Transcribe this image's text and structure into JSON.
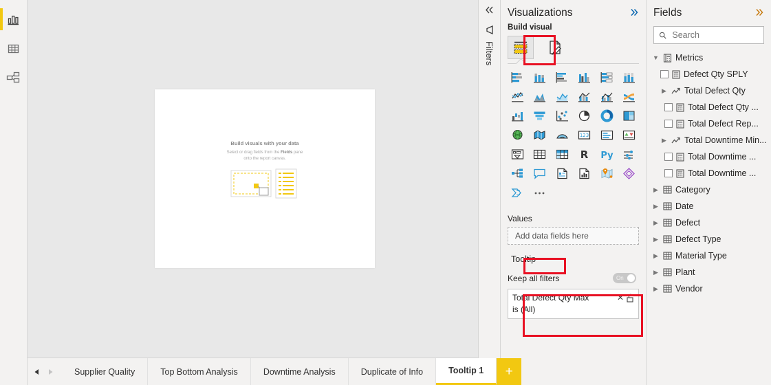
{
  "left_rail": {
    "items": [
      {
        "name": "report-view",
        "icon": "bar-chart-icon",
        "active": true
      },
      {
        "name": "data-view",
        "icon": "table-icon",
        "active": false
      },
      {
        "name": "model-view",
        "icon": "model-relationship-icon",
        "active": false
      }
    ]
  },
  "canvas": {
    "placeholder_title": "Build visuals with your data",
    "placeholder_line1": "Select or drag fields from the ",
    "placeholder_bold": "Fields",
    "placeholder_line2": " pane",
    "placeholder_line3": "onto the report canvas."
  },
  "filters_pane": {
    "collapse_icon": "chevron-double-left-icon",
    "filter_icon": "filter-funnel-icon",
    "label": "Filters"
  },
  "visualizations": {
    "title": "Visualizations",
    "expand_icon": "chevron-double-right-icon",
    "build_visual_label": "Build visual",
    "build_tabs": [
      {
        "name": "build-visual-tab",
        "icon": "visual-fields-icon",
        "selected": true
      },
      {
        "name": "format-visual-tab",
        "icon": "format-paintbrush-icon",
        "selected": false
      }
    ],
    "visual_types": [
      "stacked-bar-chart",
      "stacked-column-chart",
      "clustered-bar-chart",
      "clustered-column-chart",
      "100-stacked-bar-chart",
      "100-stacked-column-chart",
      "line-chart",
      "area-chart",
      "stacked-area-chart",
      "line-and-stacked-column-chart",
      "line-and-clustered-column-chart",
      "ribbon-chart",
      "waterfall-chart",
      "funnel-chart",
      "scatter-chart",
      "pie-chart",
      "donut-chart",
      "treemap",
      "map",
      "filled-map",
      "arcgis-map",
      "card",
      "multi-row-card",
      "kpi",
      "slicer",
      "table",
      "matrix",
      "r-script-visual",
      "python-visual",
      "key-influencers",
      "decomposition-tree",
      "q-and-a",
      "narrative",
      "paginated-report",
      "azure-map",
      "power-apps",
      "power-automate"
    ],
    "more_icon": "ellipsis-icon",
    "wells": {
      "values_title": "Values",
      "values_placeholder": "Add data fields here",
      "tooltip_title": "Tooltip",
      "keep_all_filters_label": "Keep all filters",
      "keep_all_filters_state": "On",
      "filter_card": {
        "field_name": "Total Defect Qty Max",
        "clear_icon": "close-x-icon",
        "lock_icon": "lock-open-icon",
        "condition": "is (All)"
      }
    }
  },
  "fields": {
    "title": "Fields",
    "expand_icon": "chevron-double-right-icon",
    "search_placeholder": "Search",
    "search_icon": "search-icon",
    "tree": [
      {
        "label": "Metrics",
        "type": "folder-expanded",
        "icon": "measure-table-icon",
        "indent": 0,
        "twisty": "v",
        "checkbox": false
      },
      {
        "label": "Defect Qty SPLY",
        "type": "measure",
        "icon": "measure-icon",
        "indent": 1,
        "twisty": "",
        "checkbox": true
      },
      {
        "label": "Total Defect Qty",
        "type": "display-folder",
        "icon": "trend-arrow-icon",
        "indent": 1,
        "twisty": ">",
        "checkbox": false
      },
      {
        "label": "Total Defect Qty ...",
        "type": "measure",
        "icon": "measure-icon",
        "indent": 2,
        "twisty": "",
        "checkbox": true
      },
      {
        "label": "Total Defect Rep...",
        "type": "measure",
        "icon": "measure-icon",
        "indent": 2,
        "twisty": "",
        "checkbox": true
      },
      {
        "label": "Total Downtime Min...",
        "type": "display-folder",
        "icon": "trend-arrow-icon",
        "indent": 1,
        "twisty": ">",
        "checkbox": false
      },
      {
        "label": "Total Downtime ...",
        "type": "measure",
        "icon": "measure-icon",
        "indent": 2,
        "twisty": "",
        "checkbox": true
      },
      {
        "label": "Total Downtime ...",
        "type": "measure",
        "icon": "measure-icon",
        "indent": 2,
        "twisty": "",
        "checkbox": true
      },
      {
        "label": "Category",
        "type": "table",
        "icon": "table-icon",
        "indent": 0,
        "twisty": ">",
        "checkbox": false
      },
      {
        "label": "Date",
        "type": "table",
        "icon": "table-icon",
        "indent": 0,
        "twisty": ">",
        "checkbox": false
      },
      {
        "label": "Defect",
        "type": "table",
        "icon": "table-icon",
        "indent": 0,
        "twisty": ">",
        "checkbox": false
      },
      {
        "label": "Defect Type",
        "type": "table",
        "icon": "table-icon",
        "indent": 0,
        "twisty": ">",
        "checkbox": false
      },
      {
        "label": "Material Type",
        "type": "table",
        "icon": "table-icon",
        "indent": 0,
        "twisty": ">",
        "checkbox": false
      },
      {
        "label": "Plant",
        "type": "table",
        "icon": "table-icon",
        "indent": 0,
        "twisty": ">",
        "checkbox": false
      },
      {
        "label": "Vendor",
        "type": "table",
        "icon": "table-icon",
        "indent": 0,
        "twisty": ">",
        "checkbox": false
      }
    ]
  },
  "page_tabs": {
    "prev_icon": "triangle-left-icon",
    "next_icon": "triangle-right-icon",
    "add_label": "+",
    "tabs": [
      {
        "label": "Supplier Quality",
        "active": false
      },
      {
        "label": "Top Bottom Analysis",
        "active": false
      },
      {
        "label": "Downtime Analysis",
        "active": false
      },
      {
        "label": "Duplicate of Info",
        "active": false
      },
      {
        "label": "Tooltip 1",
        "active": true
      }
    ]
  },
  "colors": {
    "accent_yellow": "#f2c811",
    "annotation_red": "#e81123",
    "link_blue": "#0a67b1",
    "pane_bg": "#f3f2f1",
    "canvas_bg": "#e8e8e8"
  }
}
